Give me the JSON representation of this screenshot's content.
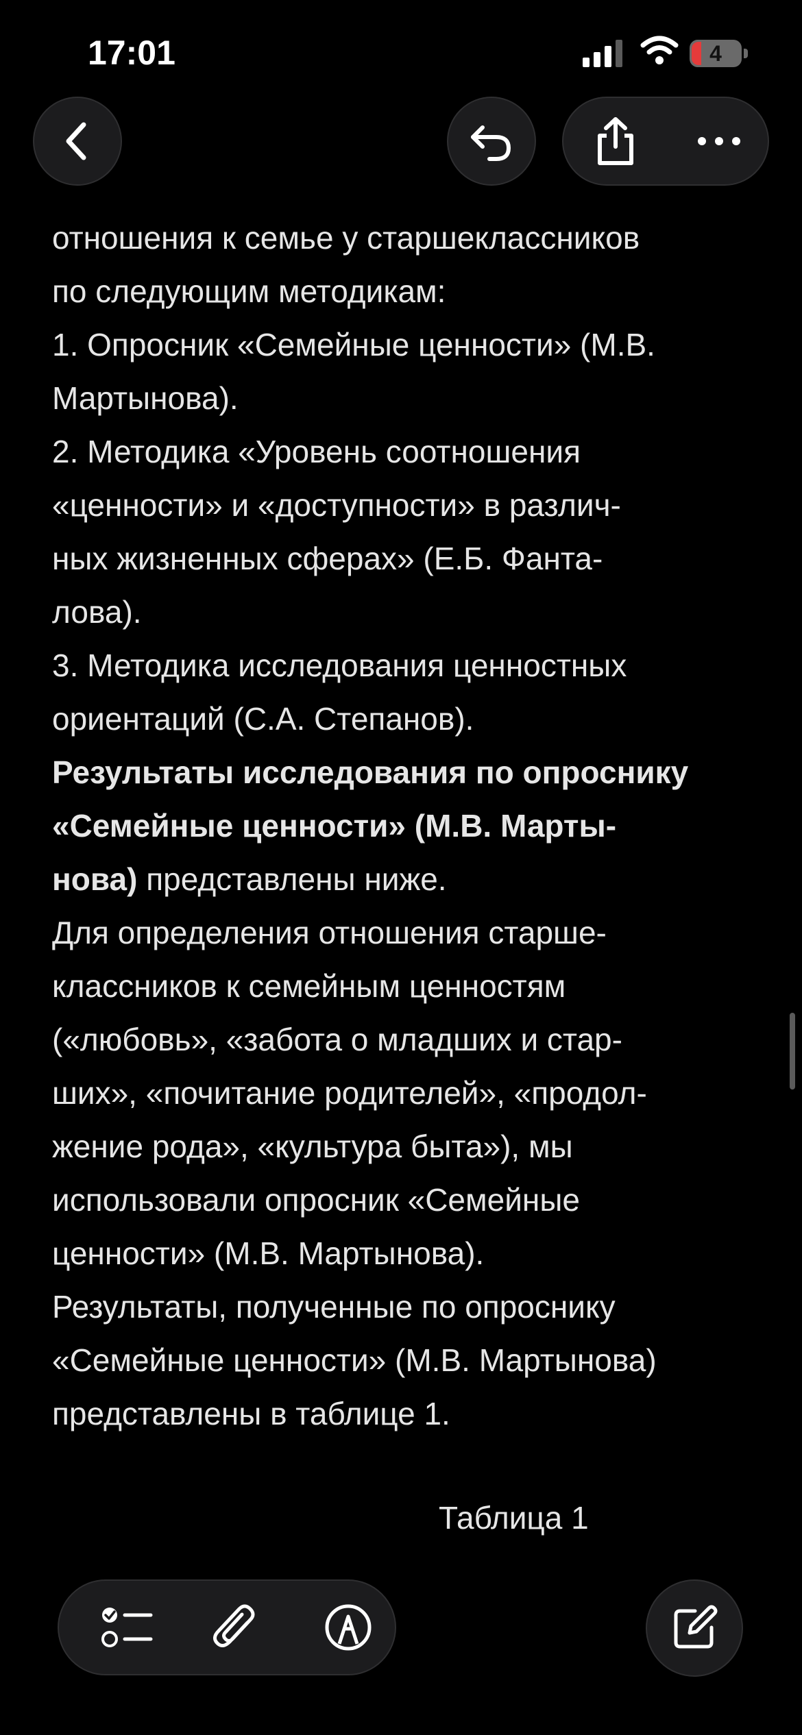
{
  "status_bar": {
    "time": "17:01",
    "battery_level": "4"
  },
  "nav": {
    "back_icon": "chevron-left-icon",
    "undo_icon": "undo-icon",
    "share_icon": "share-icon",
    "more_icon": "ellipsis-icon"
  },
  "document": {
    "lines": [
      "отношения к семье у старшеклассников",
      "по следующим методикам:",
      "1. Опросник «Семейные ценности» (М.В.",
      "Мартынова).",
      "2. Методика «Уровень соотношения",
      "«ценности» и «доступности» в различ-",
      "ных жизненных сферах» (Е.Б. Фанта-",
      "лова).",
      "3. Методика исследования ценностных",
      "ориентаций (С.А. Степанов)."
    ],
    "results_bold_1": "Результаты исследования по опроснику",
    "results_bold_2": "«Семейные ценности» (М.В. Марты-",
    "results_bold_3": "нова)",
    "results_rest": " представлены ниже.",
    "paragraph_lines": [
      "Для определения отношения старше-",
      "классников к семейным ценностям",
      "(«любовь», «забота о младших и стар-",
      "ших», «почитание родителей», «продол-",
      "жение рода», «культура быта»), мы",
      "использовали опросник «Семейные",
      "ценности» (М.В. Мартынова).",
      "Результаты, полученные по опроснику",
      "«Семейные ценности» (М.В. Мартынова)",
      "представлены в таблице 1."
    ],
    "table_caption": "Таблица 1"
  },
  "toolbar": {
    "checklist_icon": "checklist-icon",
    "attach_icon": "paperclip-icon",
    "markup_icon": "markup-pen-icon",
    "compose_icon": "compose-icon"
  }
}
